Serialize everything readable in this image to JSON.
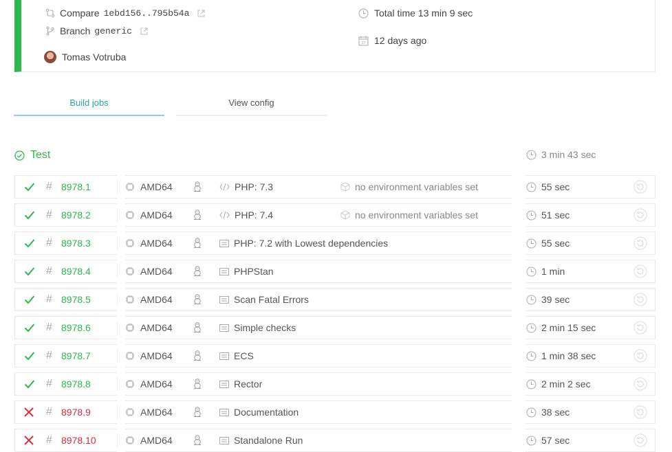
{
  "summary": {
    "compare_label": "Compare",
    "compare_range": "1ebd156..795b54a",
    "branch_label": "Branch",
    "branch_name": "generic",
    "author": "Tomas Votruba",
    "total_time": "Total time 13 min 9 sec",
    "ago": "12 days ago"
  },
  "tabs": [
    {
      "label": "Build jobs",
      "active": true
    },
    {
      "label": "View config",
      "active": false
    }
  ],
  "stage": {
    "title": "Test",
    "duration": "3 min 43 sec"
  },
  "colors": {
    "passed": "#2db84d",
    "failed": "#d62f3b",
    "accent": "#2aa6a6"
  },
  "jobs": [
    {
      "number": "8978.1",
      "status": "passed",
      "arch": "AMD64",
      "os": "linux",
      "lang_icon": "code-icon",
      "label": "PHP: 7.3",
      "env": "no environment variables set",
      "duration": "55 sec"
    },
    {
      "number": "8978.2",
      "status": "passed",
      "arch": "AMD64",
      "os": "linux",
      "lang_icon": "code-icon",
      "label": "PHP: 7.4",
      "env": "no environment variables set",
      "duration": "51 sec"
    },
    {
      "number": "8978.3",
      "status": "passed",
      "arch": "AMD64",
      "os": "linux",
      "lang_icon": "job-name-icon",
      "label": "PHP: 7.2 with Lowest dependencies",
      "env": "",
      "duration": "55 sec"
    },
    {
      "number": "8978.4",
      "status": "passed",
      "arch": "AMD64",
      "os": "linux",
      "lang_icon": "job-name-icon",
      "label": "PHPStan",
      "env": "",
      "duration": "1 min"
    },
    {
      "number": "8978.5",
      "status": "passed",
      "arch": "AMD64",
      "os": "linux",
      "lang_icon": "job-name-icon",
      "label": "Scan Fatal Errors",
      "env": "",
      "duration": "39 sec"
    },
    {
      "number": "8978.6",
      "status": "passed",
      "arch": "AMD64",
      "os": "linux",
      "lang_icon": "job-name-icon",
      "label": "Simple checks",
      "env": "",
      "duration": "2 min 15 sec"
    },
    {
      "number": "8978.7",
      "status": "passed",
      "arch": "AMD64",
      "os": "linux",
      "lang_icon": "job-name-icon",
      "label": "ECS",
      "env": "",
      "duration": "1 min 38 sec"
    },
    {
      "number": "8978.8",
      "status": "passed",
      "arch": "AMD64",
      "os": "linux",
      "lang_icon": "job-name-icon",
      "label": "Rector",
      "env": "",
      "duration": "2 min 2 sec"
    },
    {
      "number": "8978.9",
      "status": "failed",
      "arch": "AMD64",
      "os": "linux",
      "lang_icon": "job-name-icon",
      "label": "Documentation",
      "env": "",
      "duration": "38 sec"
    },
    {
      "number": "8978.10",
      "status": "failed",
      "arch": "AMD64",
      "os": "linux",
      "lang_icon": "job-name-icon",
      "label": "Standalone Run",
      "env": "",
      "duration": "57 sec"
    }
  ]
}
